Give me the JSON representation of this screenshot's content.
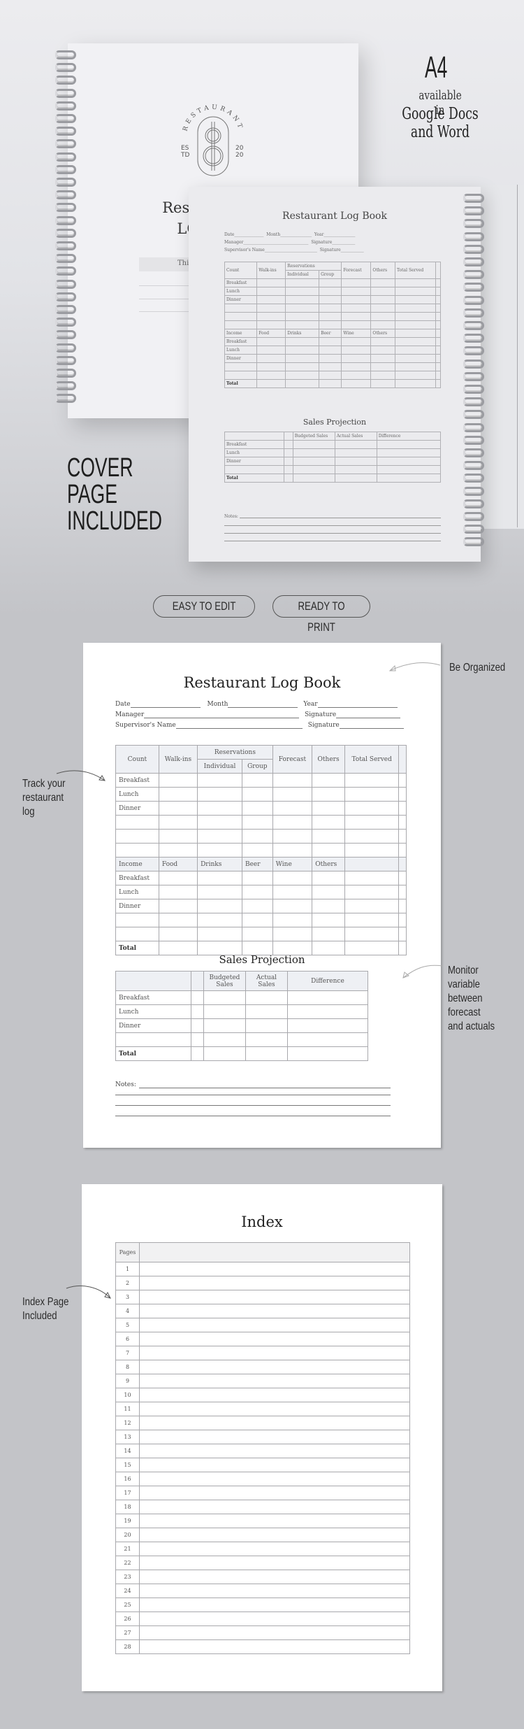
{
  "hero": {
    "format": "A4",
    "available_in": "available in",
    "apps": [
      "Google Docs",
      "and Word"
    ],
    "cover_label": [
      "COVER",
      "PAGE",
      "INCLUDED"
    ],
    "cover": {
      "logo_arc": "RESTAURANT",
      "logo_left": [
        "ES",
        "TD"
      ],
      "logo_right": [
        "20",
        "20"
      ],
      "title_partial": [
        "Restau",
        "LO"
      ],
      "box_partial": "Thi"
    }
  },
  "badges": [
    "EASY TO EDIT",
    "READY TO PRINT"
  ],
  "log_page": {
    "title": "Restaurant Log Book",
    "fields": {
      "date": "Date",
      "month": "Month",
      "year": "Year",
      "manager": "Manager",
      "signature1": "Signature",
      "supervisor": "Supervisor's Name",
      "signature2": "Signature"
    },
    "count_table": {
      "headers": [
        "Count",
        "Walk-ins",
        "Reservations",
        "Forecast",
        "Others",
        "Total Served"
      ],
      "sub_headers": [
        "Individual",
        "Group"
      ],
      "rows": [
        "Breakfast",
        "Lunch",
        "Dinner",
        "",
        "",
        ""
      ]
    },
    "income_table": {
      "headers": [
        "Income",
        "Food",
        "Drinks",
        "Beer",
        "Wine",
        "Others"
      ],
      "rows": [
        "Breakfast",
        "Lunch",
        "Dinner",
        "",
        ""
      ],
      "total": "Total"
    },
    "sales_title": "Sales Projection",
    "sales_table": {
      "headers": [
        "",
        "",
        "Budgeted Sales",
        "Actual Sales",
        "Difference"
      ],
      "rows": [
        "Breakfast",
        "Lunch",
        "Dinner",
        ""
      ],
      "total": "Total"
    },
    "notes_label": "Notes:"
  },
  "callouts": {
    "be_organized": "Be Organized",
    "track": [
      "Track your",
      "restaurant",
      "log"
    ],
    "monitor": [
      "Monitor",
      "variable",
      "between",
      "forecast",
      "and actuals"
    ],
    "index": [
      "Index Page",
      "Included"
    ]
  },
  "index_page": {
    "title": "Index",
    "header": "Pages",
    "rows": [
      "1",
      "2",
      "3",
      "4",
      "5",
      "6",
      "7",
      "8",
      "9",
      "10",
      "11",
      "12",
      "13",
      "14",
      "15",
      "16",
      "17",
      "18",
      "19",
      "20",
      "21",
      "22",
      "23",
      "24",
      "25",
      "26",
      "27",
      "28"
    ]
  }
}
